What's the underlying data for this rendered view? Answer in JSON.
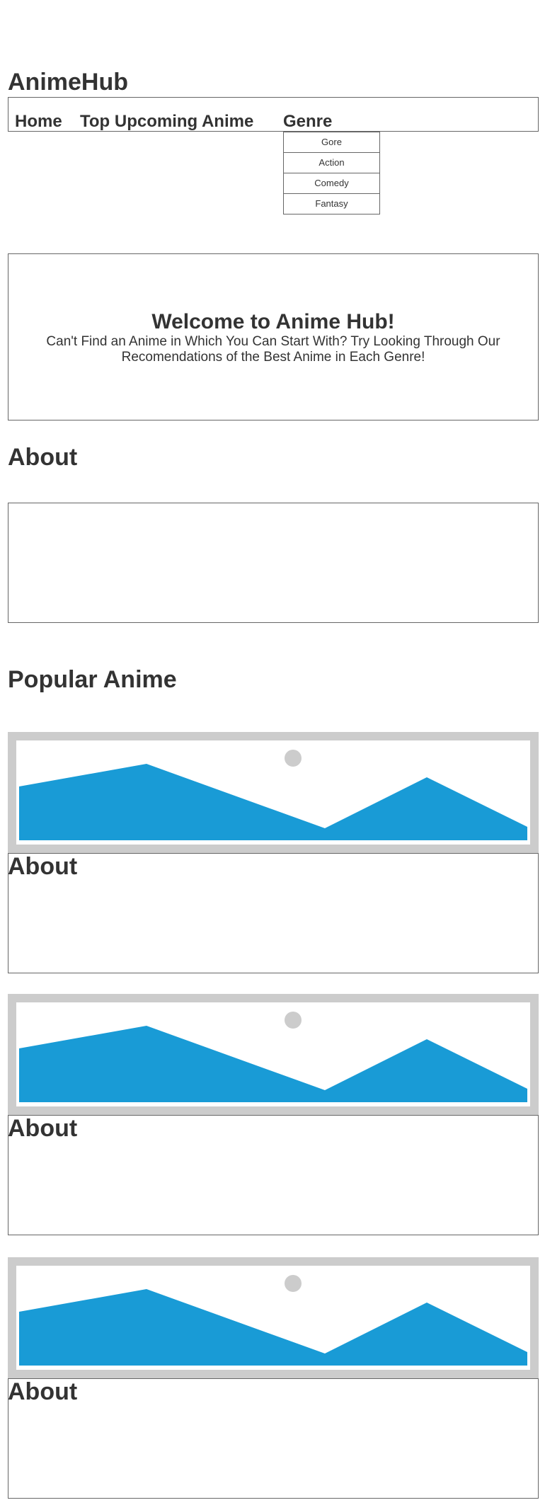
{
  "site": {
    "title": "AnimeHub"
  },
  "nav": {
    "home": "Home",
    "upcoming": "Top Upcoming Anime",
    "genre": "Genre",
    "genre_options": [
      "Gore",
      "Action",
      "Comedy",
      "Fantasy"
    ]
  },
  "hero": {
    "title": "Welcome to Anime Hub!",
    "subtitle": "Can't Find an Anime in Which You Can Start With? Try Looking Through Our Recomendations of the Best Anime in Each Genre!"
  },
  "about": {
    "heading": "About"
  },
  "popular": {
    "heading": "Popular Anime",
    "cards": [
      {
        "title": "About",
        "image_icon": "image-placeholder-icon"
      },
      {
        "title": "About",
        "image_icon": "image-placeholder-icon"
      },
      {
        "title": "About",
        "image_icon": "image-placeholder-icon"
      }
    ]
  },
  "colors": {
    "text": "#333333",
    "border": "#666666",
    "placeholder_frame": "#cccccc",
    "placeholder_mountain": "#199bd6"
  }
}
